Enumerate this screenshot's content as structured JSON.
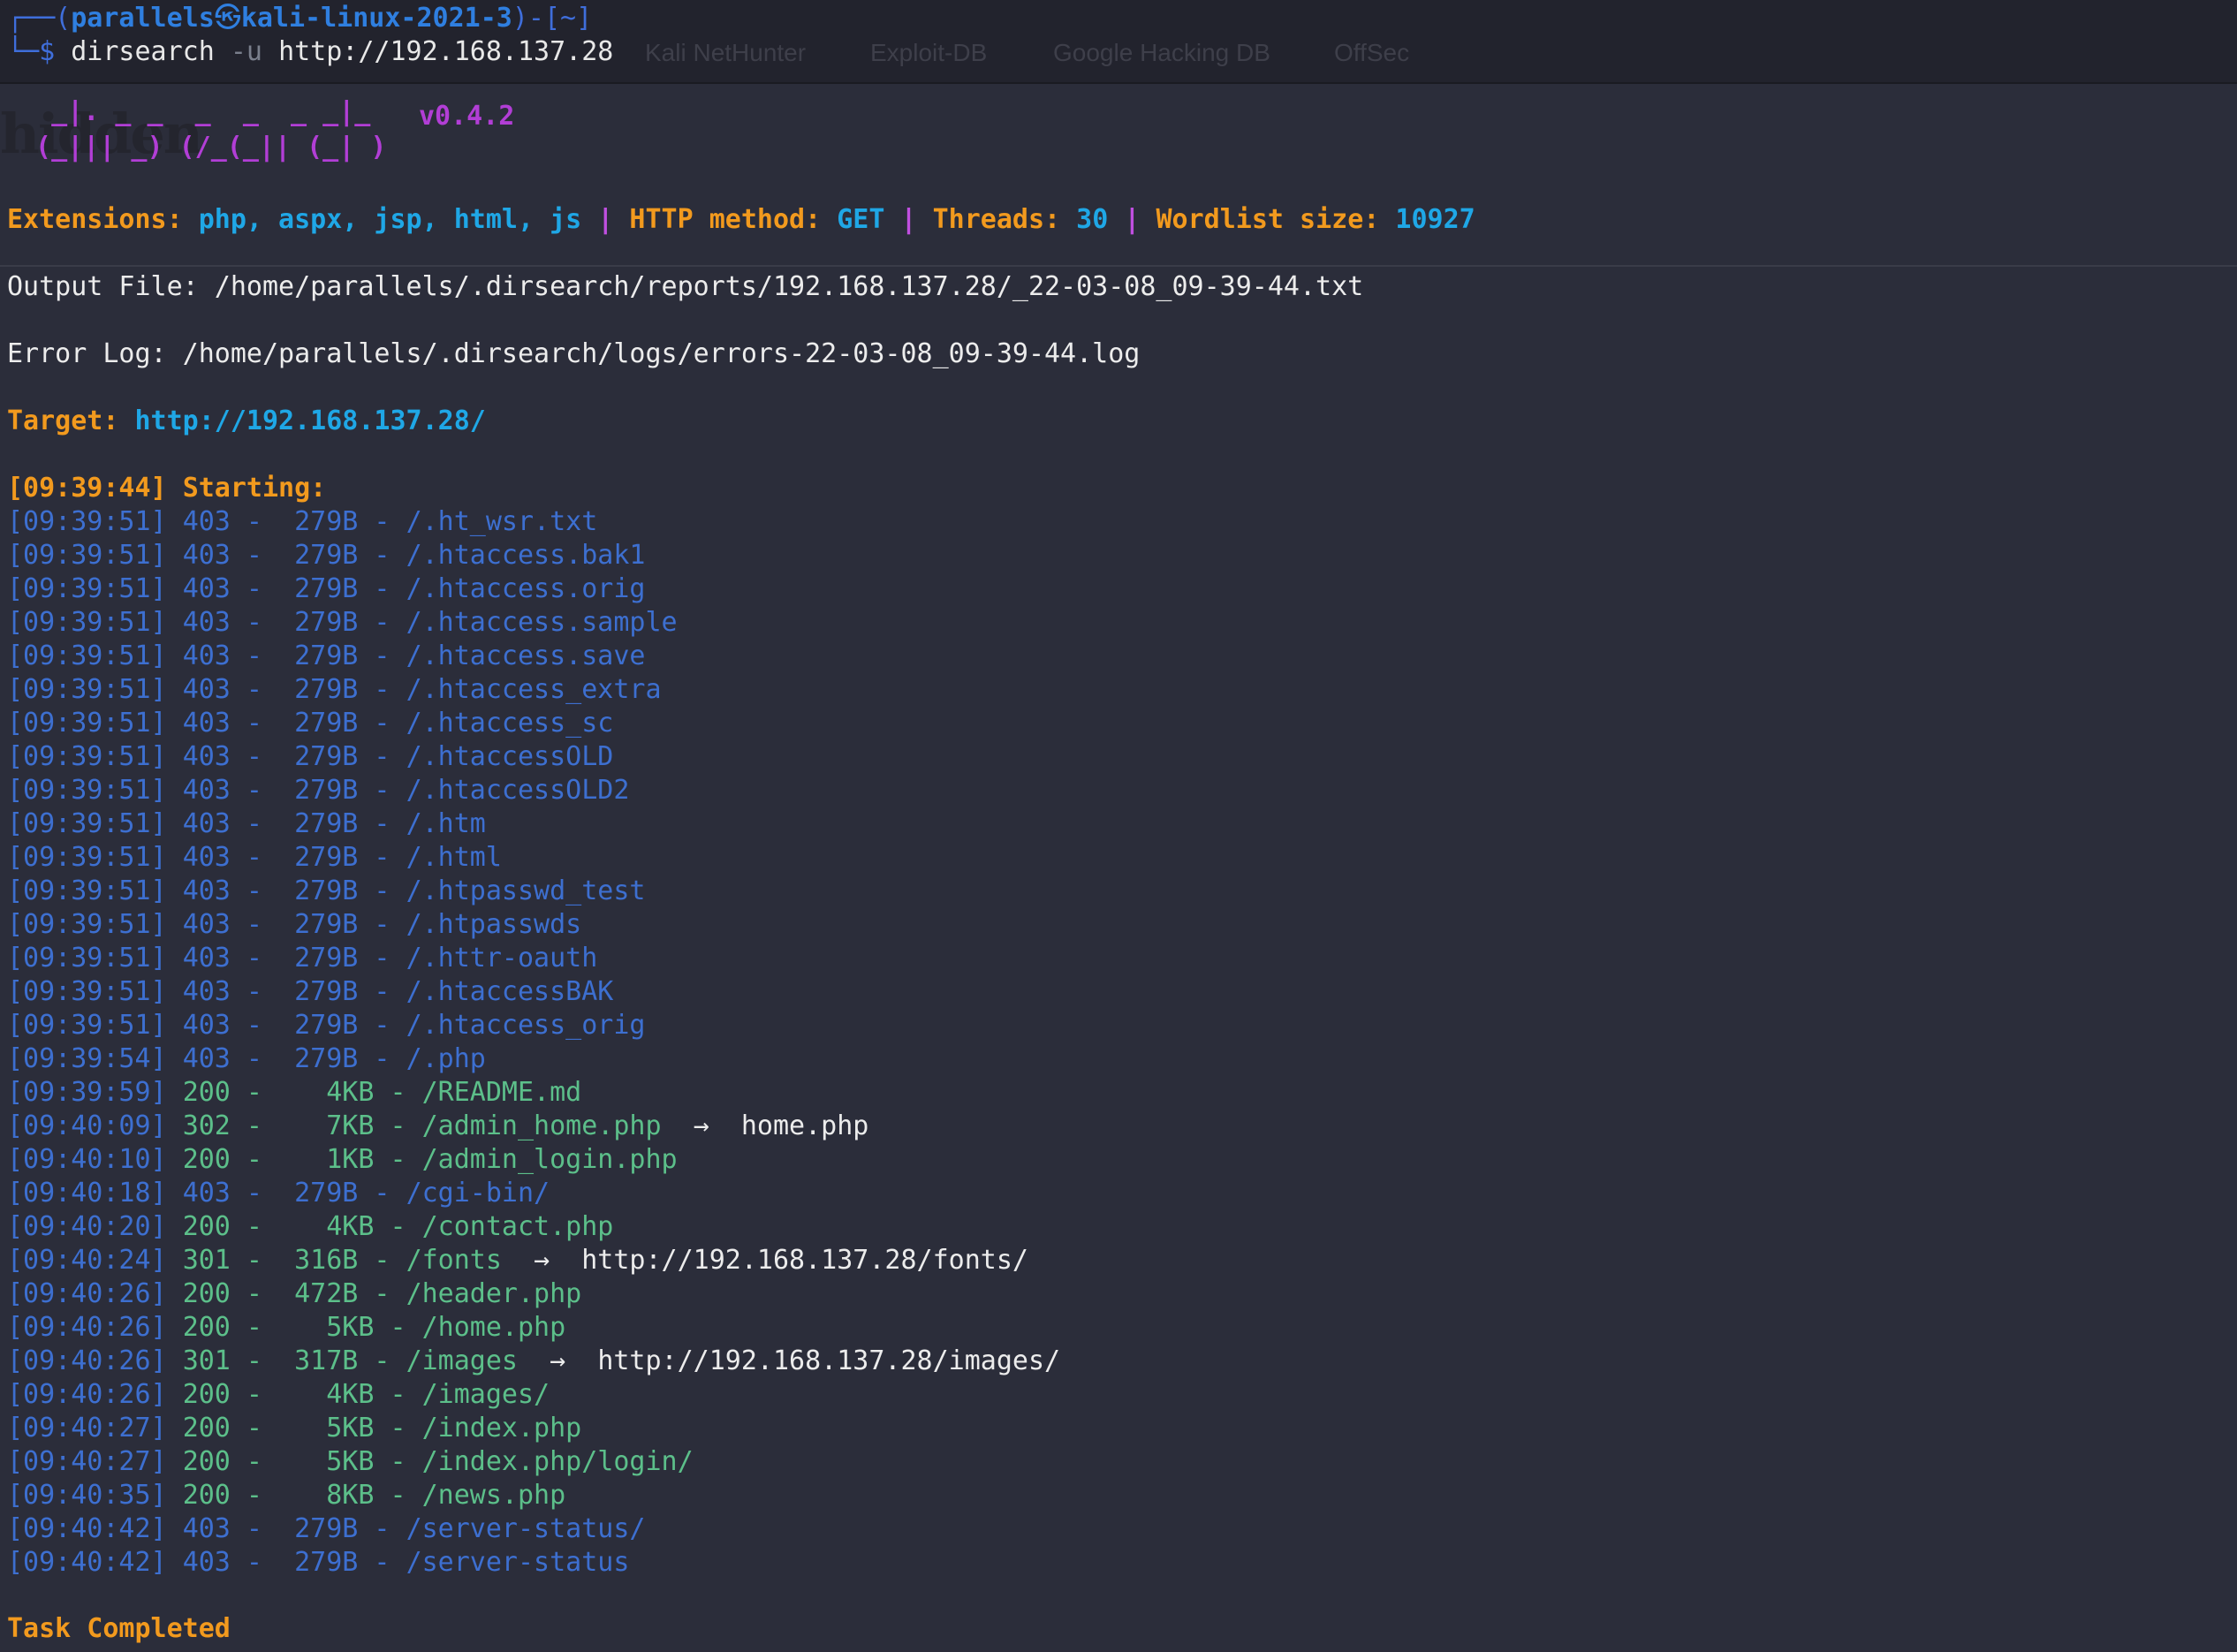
{
  "prompt": {
    "box_prefix": "┌──(",
    "user": "parallels",
    "at_symbol": "㉿",
    "host": "kali-linux-2021-3",
    "dir_part": ")-[~]",
    "line2_prefix": "└─$ ",
    "command": "dirsearch",
    "flag": "-u",
    "url": "http://192.168.137.28"
  },
  "background_tabs": [
    "Kali NetHunter",
    "Exploit-DB",
    "Google Hacking DB",
    "OffSec"
  ],
  "banner": {
    "ascii_line1": "  _|. _ _  _  _  _ _|_",
    "ascii_line2": " (_||| _) (/_(_|| (_| )",
    "version": "v0.4.2"
  },
  "config": {
    "extensions_label": "Extensions:",
    "extensions_value": "php, aspx, jsp, html, js",
    "method_label": "HTTP method:",
    "method_value": "GET",
    "threads_label": "Threads:",
    "threads_value": "30",
    "wordlist_label": "Wordlist size:",
    "wordlist_value": "10927",
    "separator": "|"
  },
  "output_file": "Output File: /home/parallels/.dirsearch/reports/192.168.137.28/_22-03-08_09-39-44.txt",
  "error_log": "Error Log: /home/parallels/.dirsearch/logs/errors-22-03-08_09-39-44.log",
  "target": {
    "label": "Target:",
    "url": "http://192.168.137.28/"
  },
  "starting": {
    "time": "[09:39:44]",
    "label": "Starting:"
  },
  "results": [
    {
      "time": "[09:39:51]",
      "code": "403",
      "size": " 279B",
      "path": "/.ht_wsr.txt",
      "redirect": ""
    },
    {
      "time": "[09:39:51]",
      "code": "403",
      "size": " 279B",
      "path": "/.htaccess.bak1",
      "redirect": ""
    },
    {
      "time": "[09:39:51]",
      "code": "403",
      "size": " 279B",
      "path": "/.htaccess.orig",
      "redirect": ""
    },
    {
      "time": "[09:39:51]",
      "code": "403",
      "size": " 279B",
      "path": "/.htaccess.sample",
      "redirect": ""
    },
    {
      "time": "[09:39:51]",
      "code": "403",
      "size": " 279B",
      "path": "/.htaccess.save",
      "redirect": ""
    },
    {
      "time": "[09:39:51]",
      "code": "403",
      "size": " 279B",
      "path": "/.htaccess_extra",
      "redirect": ""
    },
    {
      "time": "[09:39:51]",
      "code": "403",
      "size": " 279B",
      "path": "/.htaccess_sc",
      "redirect": ""
    },
    {
      "time": "[09:39:51]",
      "code": "403",
      "size": " 279B",
      "path": "/.htaccessOLD",
      "redirect": ""
    },
    {
      "time": "[09:39:51]",
      "code": "403",
      "size": " 279B",
      "path": "/.htaccessOLD2",
      "redirect": ""
    },
    {
      "time": "[09:39:51]",
      "code": "403",
      "size": " 279B",
      "path": "/.htm",
      "redirect": ""
    },
    {
      "time": "[09:39:51]",
      "code": "403",
      "size": " 279B",
      "path": "/.html",
      "redirect": ""
    },
    {
      "time": "[09:39:51]",
      "code": "403",
      "size": " 279B",
      "path": "/.htpasswd_test",
      "redirect": ""
    },
    {
      "time": "[09:39:51]",
      "code": "403",
      "size": " 279B",
      "path": "/.htpasswds",
      "redirect": ""
    },
    {
      "time": "[09:39:51]",
      "code": "403",
      "size": " 279B",
      "path": "/.httr-oauth",
      "redirect": ""
    },
    {
      "time": "[09:39:51]",
      "code": "403",
      "size": " 279B",
      "path": "/.htaccessBAK",
      "redirect": ""
    },
    {
      "time": "[09:39:51]",
      "code": "403",
      "size": " 279B",
      "path": "/.htaccess_orig",
      "redirect": ""
    },
    {
      "time": "[09:39:54]",
      "code": "403",
      "size": " 279B",
      "path": "/.php",
      "redirect": ""
    },
    {
      "time": "[09:39:59]",
      "code": "200",
      "size": "   4KB",
      "path": "/README.md",
      "redirect": ""
    },
    {
      "time": "[09:40:09]",
      "code": "302",
      "size": "   7KB",
      "path": "/admin_home.php",
      "redirect": "home.php"
    },
    {
      "time": "[09:40:10]",
      "code": "200",
      "size": "   1KB",
      "path": "/admin_login.php",
      "redirect": ""
    },
    {
      "time": "[09:40:18]",
      "code": "403",
      "size": " 279B",
      "path": "/cgi-bin/",
      "redirect": ""
    },
    {
      "time": "[09:40:20]",
      "code": "200",
      "size": "   4KB",
      "path": "/contact.php",
      "redirect": ""
    },
    {
      "time": "[09:40:24]",
      "code": "301",
      "size": " 316B",
      "path": "/fonts",
      "redirect": "http://192.168.137.28/fonts/"
    },
    {
      "time": "[09:40:26]",
      "code": "200",
      "size": " 472B",
      "path": "/header.php",
      "redirect": ""
    },
    {
      "time": "[09:40:26]",
      "code": "200",
      "size": "   5KB",
      "path": "/home.php",
      "redirect": ""
    },
    {
      "time": "[09:40:26]",
      "code": "301",
      "size": " 317B",
      "path": "/images",
      "redirect": "http://192.168.137.28/images/"
    },
    {
      "time": "[09:40:26]",
      "code": "200",
      "size": "   4KB",
      "path": "/images/",
      "redirect": ""
    },
    {
      "time": "[09:40:27]",
      "code": "200",
      "size": "   5KB",
      "path": "/index.php",
      "redirect": ""
    },
    {
      "time": "[09:40:27]",
      "code": "200",
      "size": "   5KB",
      "path": "/index.php/login/",
      "redirect": ""
    },
    {
      "time": "[09:40:35]",
      "code": "200",
      "size": "   8KB",
      "path": "/news.php",
      "redirect": ""
    },
    {
      "time": "[09:40:42]",
      "code": "403",
      "size": " 279B",
      "path": "/server-status/",
      "redirect": ""
    },
    {
      "time": "[09:40:42]",
      "code": "403",
      "size": " 279B",
      "path": "/server-status",
      "redirect": ""
    }
  ],
  "arrow_glyph": "→",
  "dash": " - ",
  "task_completed": "Task Completed",
  "colors": {
    "background": "#2b2d3a",
    "orange": "#f29a1e",
    "cyan": "#1fa7e6",
    "magenta": "#c04fe0",
    "code_403": "#3d6fd0",
    "code_ok": "#5cbf8a"
  }
}
